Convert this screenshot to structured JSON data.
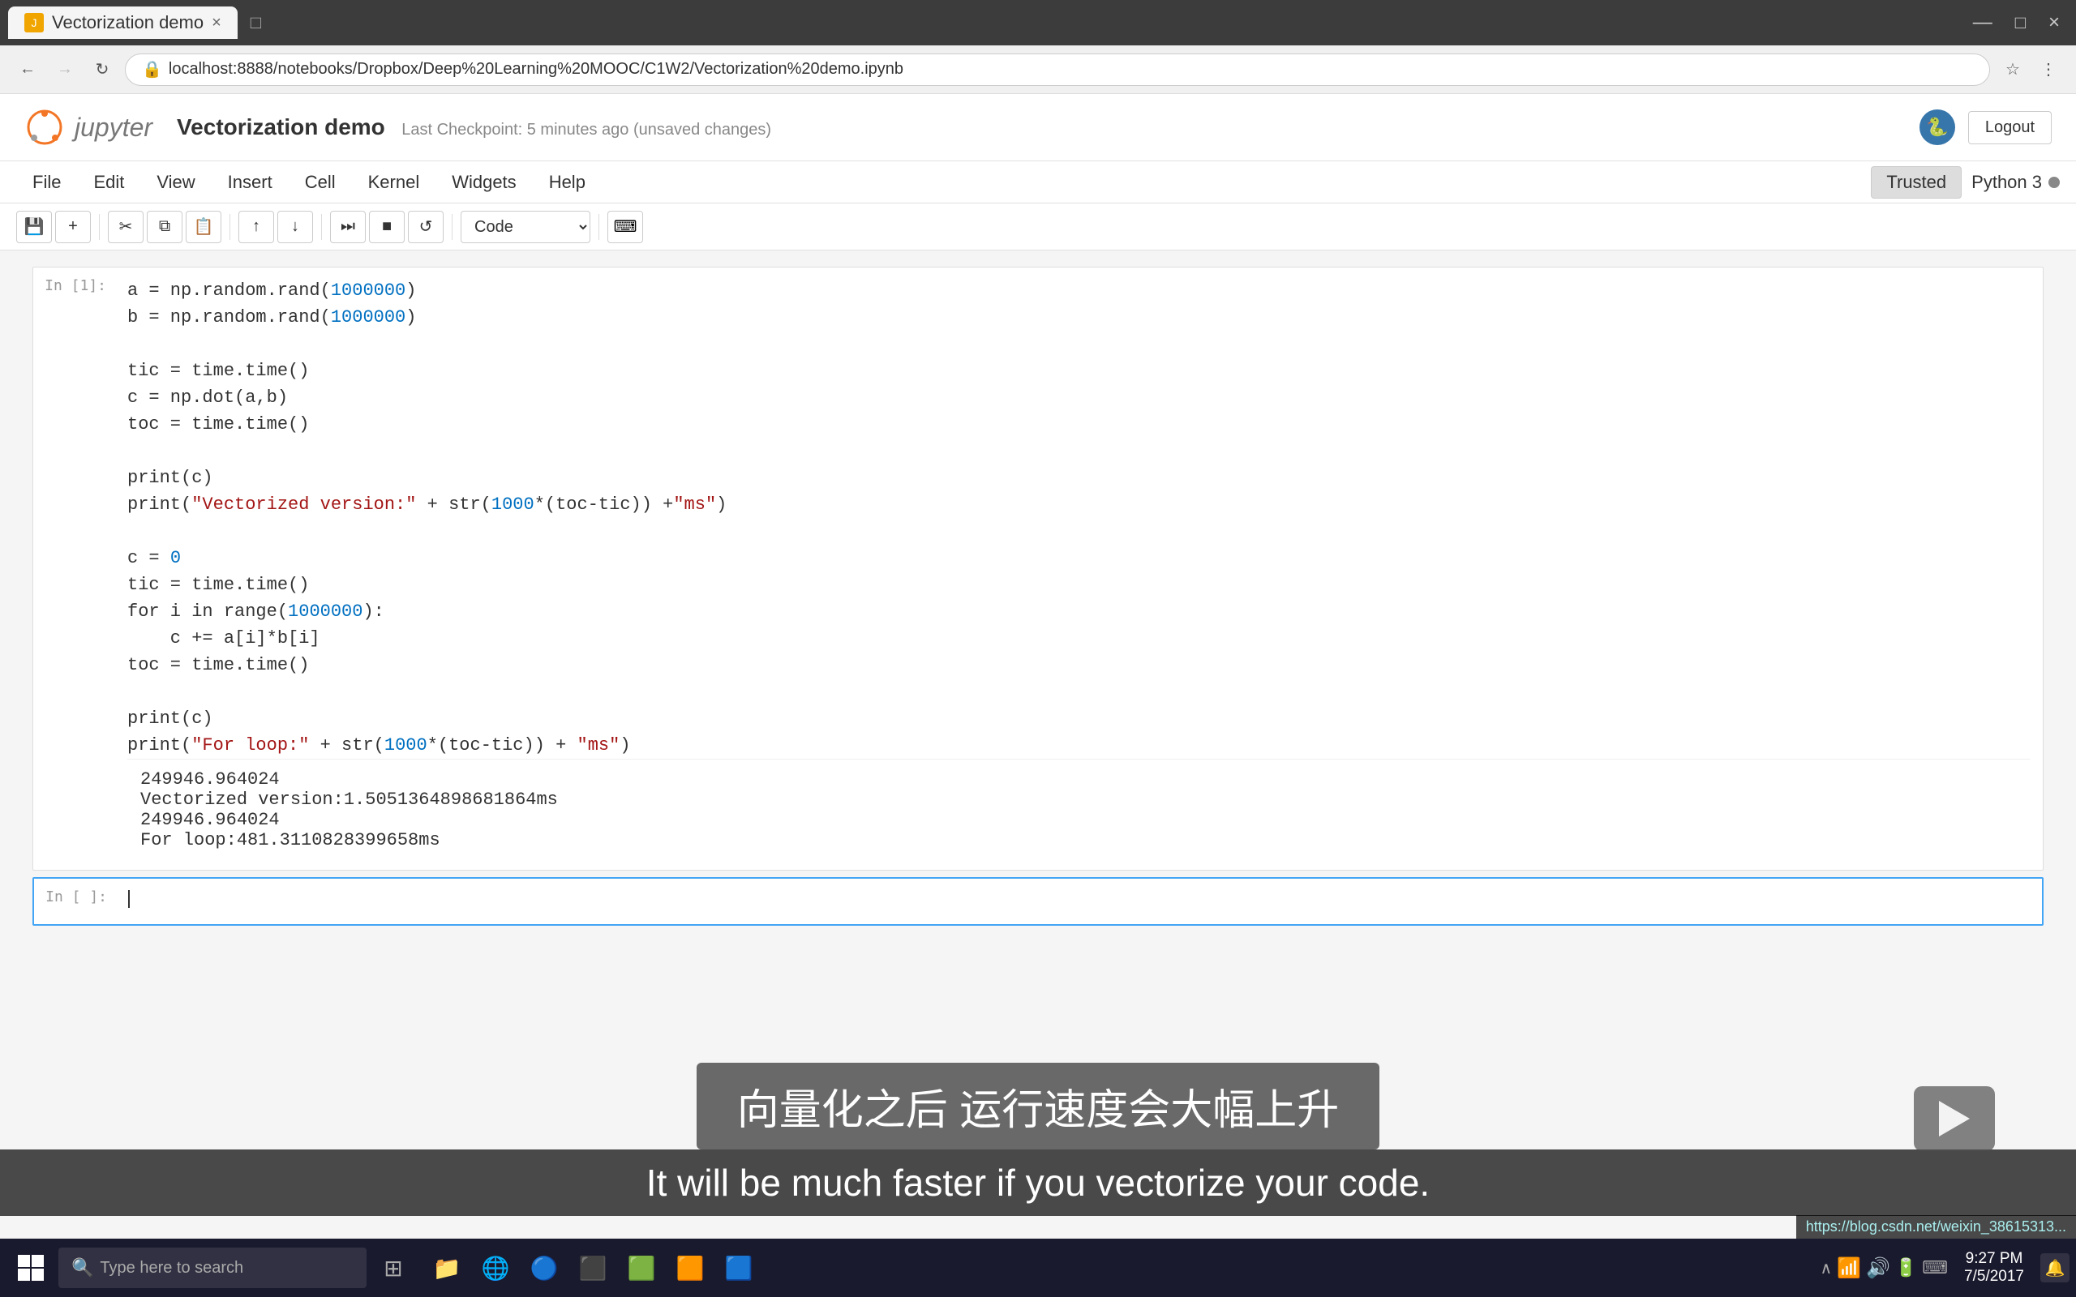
{
  "browser": {
    "tab_title": "Vectorization demo",
    "tab_favicon": "V",
    "url": "localhost:8888/notebooks/Dropbox/Deep%20Learning%20MOOC/C1W2/Vectorization%20demo.ipynb",
    "nav": {
      "back": "←",
      "forward": "→",
      "reload": "↻"
    }
  },
  "jupyter": {
    "logo_text": "jupyter",
    "notebook_name": "Vectorization demo",
    "checkpoint_text": "Last Checkpoint: 5 minutes ago (unsaved changes)",
    "logout_label": "Logout",
    "trusted_label": "Trusted",
    "kernel_label": "Python 3",
    "menu": [
      "File",
      "Edit",
      "View",
      "Insert",
      "Cell",
      "Kernel",
      "Widgets",
      "Help"
    ],
    "cell_type": "Code",
    "toolbar": {
      "save": "💾",
      "add": "+",
      "cut": "✂",
      "copy": "⧉",
      "paste": "📋",
      "move_up": "↑",
      "move_down": "↓",
      "fast_forward": "⏭",
      "stop": "■",
      "restart": "↺"
    }
  },
  "code_cell": {
    "prompt": "In [1]:",
    "lines": [
      {
        "text": "a = np.random.rand(1000000)",
        "parts": [
          {
            "t": "a = np.random.rand(",
            "c": "default"
          },
          {
            "t": "1000000",
            "c": "number"
          },
          {
            "t": ")",
            "c": "default"
          }
        ]
      },
      {
        "text": "b = np.random.rand(1000000)",
        "parts": [
          {
            "t": "b = np.random.rand(",
            "c": "default"
          },
          {
            "t": "1000000",
            "c": "number"
          },
          {
            "t": ")",
            "c": "default"
          }
        ]
      },
      {
        "text": "",
        "parts": []
      },
      {
        "text": "tic = time.time()",
        "parts": [
          {
            "t": "tic = time.time()",
            "c": "default"
          }
        ]
      },
      {
        "text": "c = np.dot(a,b)",
        "parts": [
          {
            "t": "c = np.dot(a,b)",
            "c": "default"
          }
        ]
      },
      {
        "text": "toc = time.time()",
        "parts": [
          {
            "t": "toc = time.time()",
            "c": "default"
          }
        ]
      },
      {
        "text": "",
        "parts": []
      },
      {
        "text": "print(c)",
        "parts": [
          {
            "t": "print(c)",
            "c": "default"
          }
        ]
      },
      {
        "text": "print(\"Vectorized version:\" + str(1000*(toc-tic)) +\"ms\")",
        "parts": [
          {
            "t": "print(",
            "c": "default"
          },
          {
            "t": "\"Vectorized version:\"",
            "c": "string"
          },
          {
            "t": " + str(",
            "c": "default"
          },
          {
            "t": "1000",
            "c": "number"
          },
          {
            "t": "*(toc-tic)) +",
            "c": "default"
          },
          {
            "t": "\"ms\"",
            "c": "string"
          },
          {
            "t": ")",
            "c": "default"
          }
        ]
      },
      {
        "text": "",
        "parts": []
      },
      {
        "text": "c = 0",
        "parts": [
          {
            "t": "c = ",
            "c": "default"
          },
          {
            "t": "0",
            "c": "number"
          }
        ]
      },
      {
        "text": "tic = time.time()",
        "parts": [
          {
            "t": "tic = time.time()",
            "c": "default"
          }
        ]
      },
      {
        "text": "for i in range(1000000):",
        "parts": [
          {
            "t": "for i in range(",
            "c": "default"
          },
          {
            "t": "1000000",
            "c": "number"
          },
          {
            "t": "):",
            "c": "default"
          }
        ]
      },
      {
        "text": "    c += a[i]*b[i]",
        "parts": [
          {
            "t": "    c += a[i]*b[i]",
            "c": "default"
          }
        ]
      },
      {
        "text": "toc = time.time()",
        "parts": [
          {
            "t": "toc = time.time()",
            "c": "default"
          }
        ]
      },
      {
        "text": "",
        "parts": []
      },
      {
        "text": "print(c)",
        "parts": [
          {
            "t": "print(c)",
            "c": "default"
          }
        ]
      },
      {
        "text": "print(\"For loop:\" + str(1000*(toc-tic)) + \"ms\")",
        "parts": [
          {
            "t": "print(",
            "c": "default"
          },
          {
            "t": "\"For loop:\"",
            "c": "string"
          },
          {
            "t": " + str(",
            "c": "default"
          },
          {
            "t": "1000",
            "c": "number"
          },
          {
            "t": "*(toc-tic)) + ",
            "c": "default"
          },
          {
            "t": "\"ms\"",
            "c": "string"
          },
          {
            "t": ")",
            "c": "default"
          }
        ]
      }
    ],
    "output_lines": [
      "249946.964024",
      "Vectorized version:1.5051364898681864ms",
      "249946.964024",
      "For loop:481.3110828399658ms"
    ]
  },
  "empty_cell": {
    "prompt": "In [ ]:"
  },
  "subtitle": {
    "chinese": "向量化之后 运行速度会大幅上升",
    "english": "It will be much faster if you vectorize your code."
  },
  "taskbar": {
    "search_placeholder": "Type here to search",
    "time": "9:27 PM",
    "date": "7/5/2017",
    "status_url": "https://blog.csdn.net/weixin_38615313..."
  }
}
